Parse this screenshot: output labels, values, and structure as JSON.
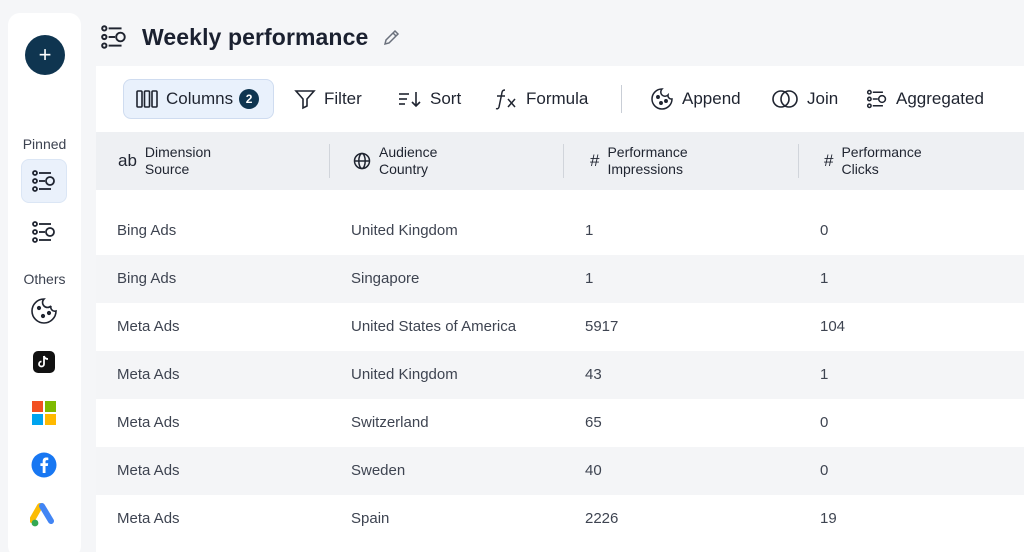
{
  "title": "Weekly performance",
  "rail": {
    "add_label": "+",
    "pinned_label": "Pinned",
    "others_label": "Others"
  },
  "toolbar": {
    "columns_label": "Columns",
    "columns_count": "2",
    "filter_label": "Filter",
    "sort_label": "Sort",
    "formula_label": "Formula",
    "append_label": "Append",
    "join_label": "Join",
    "aggregated_label": "Aggregated"
  },
  "columns": [
    {
      "type_icon": "ab",
      "line1": "Dimension",
      "line2": "Source"
    },
    {
      "type_icon": "globe",
      "line1": "Audience",
      "line2": "Country"
    },
    {
      "type_icon": "#",
      "line1": "Performance",
      "line2": "Impressions"
    },
    {
      "type_icon": "#",
      "line1": "Performance",
      "line2": "Clicks"
    }
  ],
  "rows": [
    [
      "Bing Ads",
      "United Kingdom",
      "1",
      "0"
    ],
    [
      "Bing Ads",
      "Singapore",
      "1",
      "1"
    ],
    [
      "Meta Ads",
      "United States of America",
      "5917",
      "104"
    ],
    [
      "Meta Ads",
      "United Kingdom",
      "43",
      "1"
    ],
    [
      "Meta Ads",
      "Switzerland",
      "65",
      "0"
    ],
    [
      "Meta Ads",
      "Sweden",
      "40",
      "0"
    ],
    [
      "Meta Ads",
      "Spain",
      "2226",
      "19"
    ]
  ],
  "colors": {
    "accent": "#0f3550",
    "active_bg": "#e9f1fc",
    "header_bg": "#eef0f3",
    "alt_row": "#f4f5f7"
  }
}
